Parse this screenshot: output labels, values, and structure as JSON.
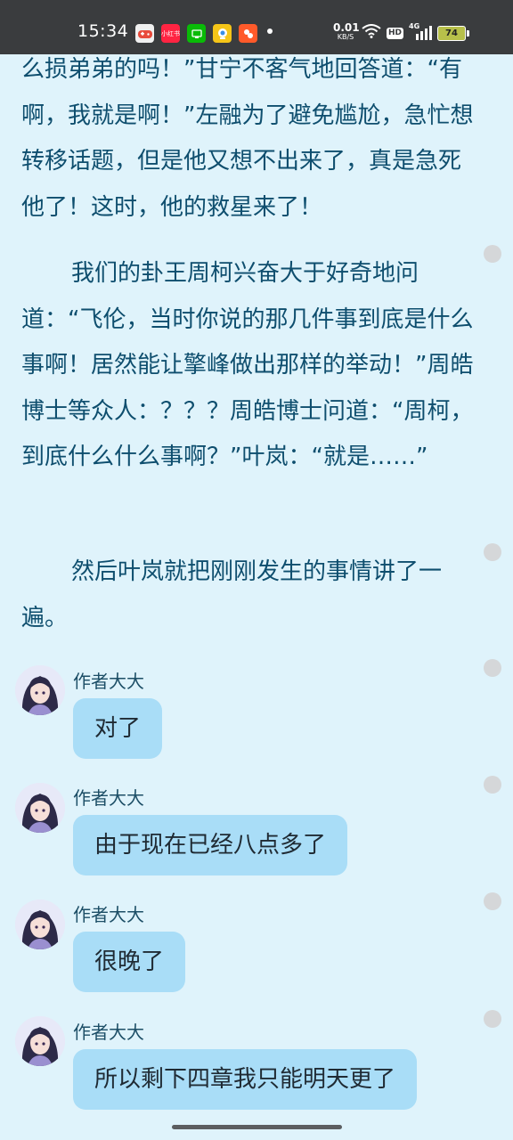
{
  "status_bar": {
    "time": "15:34",
    "app_icons": [
      {
        "name": "game-app-icon",
        "label": "",
        "color": "#f0f0f0"
      },
      {
        "name": "xiaohongshu-app-icon",
        "label": "小红书",
        "color": "#ff2442"
      },
      {
        "name": "wechat-app-icon",
        "label": "",
        "color": "#09bb07"
      },
      {
        "name": "browser-app-icon",
        "label": "",
        "color": "#f5c518"
      },
      {
        "name": "taobao-app-icon",
        "label": "",
        "color": "#ff5a2a"
      }
    ],
    "net_speed_value": "0.01",
    "net_speed_unit": "KB/S",
    "hd_label": "HD",
    "network_label": "4G",
    "battery_level": "74"
  },
  "story": {
    "paragraph1": "么损弟弟的吗！”甘宁不客气地回答道：“有啊，我就是啊！”左融为了避免尴尬，急忙想转移话题，但是他又想不出来了，真是急死他了！这时，他的救星来了！",
    "paragraph2": "我们的卦王周柯兴奋大于好奇地问道：“飞伦，当时你说的那几件事到底是什么事啊！居然能让擎峰做出那样的举动！”周皓博士等众人：？？？周皓博士问道：“周柯，到底什么什么事啊？”叶岚：“就是……”",
    "paragraph3": "然后叶岚就把刚刚发生的事情讲了一遍。"
  },
  "comments": [
    {
      "author": "作者大大",
      "text": "对了"
    },
    {
      "author": "作者大大",
      "text": "由于现在已经八点多了"
    },
    {
      "author": "作者大大",
      "text": "很晚了"
    },
    {
      "author": "作者大大",
      "text": "所以剩下四章我只能明天更了"
    }
  ],
  "colors": {
    "background": "#dff3fb",
    "status_bar": "#3a3c3e",
    "story_text": "#0e4e6e",
    "bubble": "#a9ddf7"
  }
}
